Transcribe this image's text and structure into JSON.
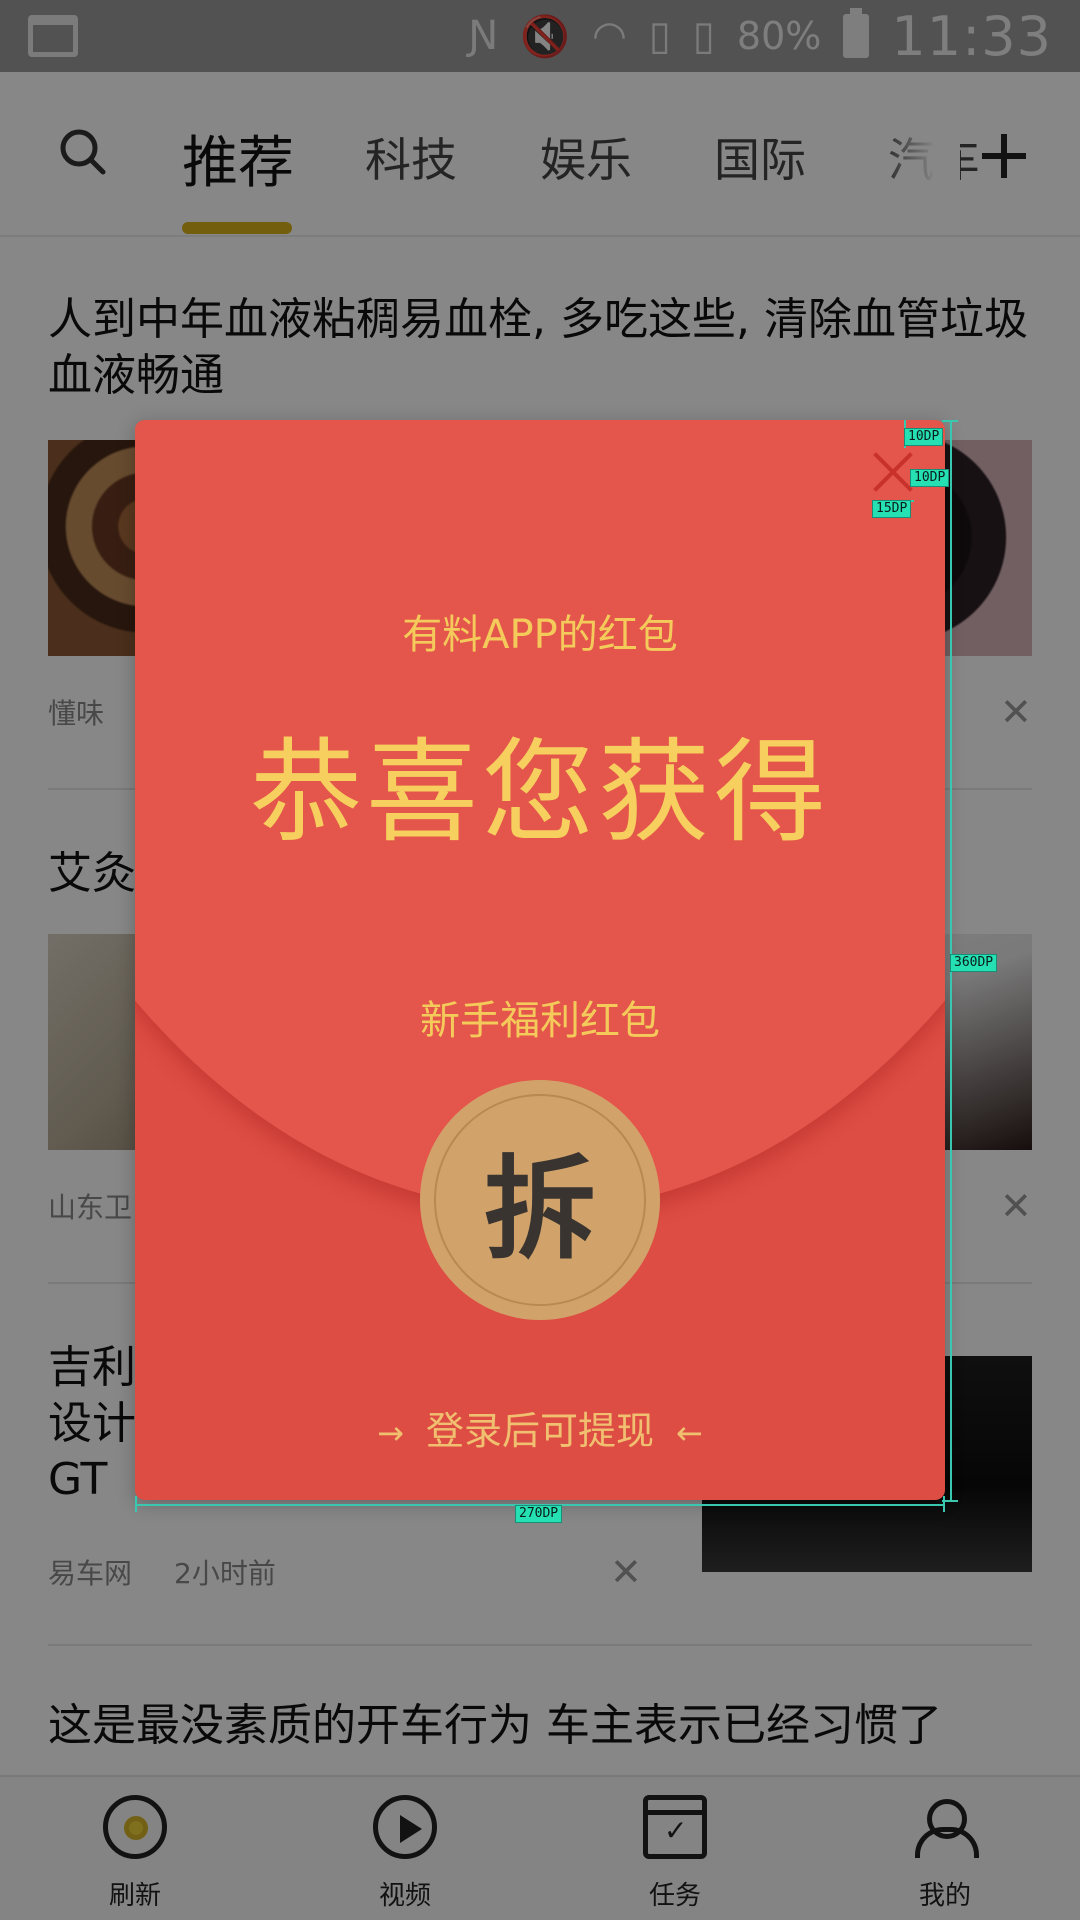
{
  "status_bar": {
    "battery": "80%",
    "time": "11:33"
  },
  "top_nav": {
    "tabs": [
      "推荐",
      "科技",
      "娱乐",
      "国际",
      "汽车"
    ],
    "active_tab": "推荐"
  },
  "feed": {
    "articles": [
      {
        "title": "人到中年血液粘稠易血栓, 多吃这些, 清除血管垃圾血液畅通",
        "source": "懂味",
        "time": ""
      },
      {
        "title": "艾灸",
        "source": "山东卫",
        "time": ""
      },
      {
        "title_lines": [
          "吉利",
          "设计",
          "GT"
        ],
        "source": "易车网",
        "time": "2小时前"
      },
      {
        "title": "这是最没素质的开车行为 车主表示已经习惯了"
      }
    ]
  },
  "bottom_nav": {
    "items": [
      {
        "label": "刷新",
        "icon": "refresh-icon"
      },
      {
        "label": "视频",
        "icon": "video-play-icon"
      },
      {
        "label": "任务",
        "icon": "task-calendar-icon"
      },
      {
        "label": "我的",
        "icon": "profile-icon"
      }
    ]
  },
  "red_packet": {
    "subtitle": "有料APP的红包",
    "headline": "恭喜您获得",
    "type": "新手福利红包",
    "open_label": "拆",
    "login_hint": "登录后可提现",
    "colors": {
      "background": "#dd4d43",
      "text": "#f6cf5e",
      "button": "#d1a36a"
    }
  },
  "annotations": {
    "top_gap": "10DP",
    "right_gap": "10DP",
    "close_size": "15DP",
    "height": "360DP",
    "width": "270DP"
  }
}
